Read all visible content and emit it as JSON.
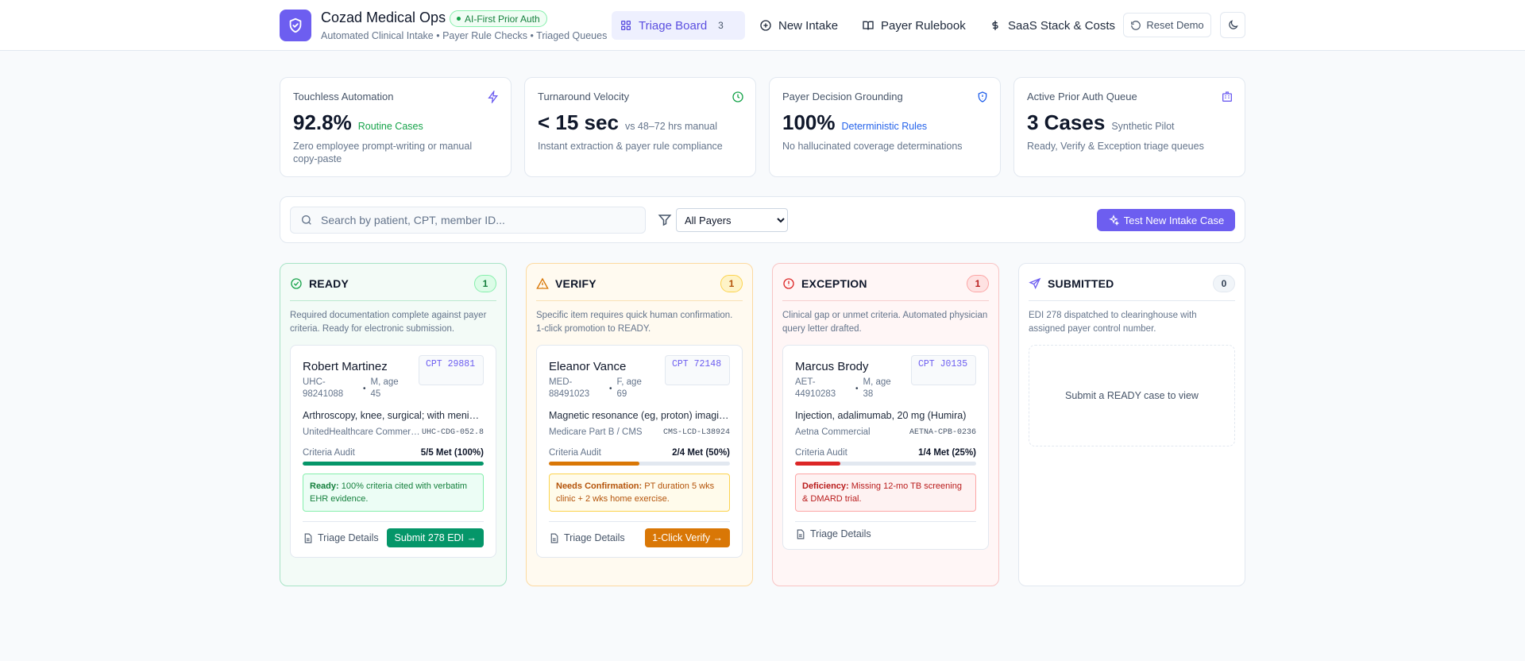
{
  "header": {
    "title": "Cozad Medical Ops",
    "badge": "AI-First Prior Auth",
    "subtitle": "Automated Clinical Intake • Payer Rule Checks • Triaged Queues",
    "nav": {
      "triage_board": "Triage Board",
      "triage_count": "3",
      "new_intake": "New Intake",
      "payer_rulebook": "Payer Rulebook",
      "saas_stack": "SaaS Stack & Costs"
    },
    "reset_label": "Reset Demo"
  },
  "stats": [
    {
      "label": "Touchless Automation",
      "value": "92.8%",
      "tag": "Routine Cases",
      "desc": "Zero employee prompt-writing or manual copy-paste",
      "icon": "zap-icon",
      "tag_color": "#16a34a"
    },
    {
      "label": "Turnaround Velocity",
      "value": "< 15 sec",
      "tag": "vs 48–72 hrs manual",
      "desc": "Instant extraction & payer rule compliance",
      "icon": "clock-icon",
      "tag_color": "#64748b"
    },
    {
      "label": "Payer Decision Grounding",
      "value": "100%",
      "tag": "Deterministic Rules",
      "desc": "No hallucinated coverage determinations",
      "icon": "shield-icon",
      "tag_color": "#2563eb"
    },
    {
      "label": "Active Prior Auth Queue",
      "value": "3 Cases",
      "tag": "Synthetic Pilot",
      "desc": "Ready, Verify & Exception triage queues",
      "icon": "building-icon",
      "tag_color": "#64748b"
    }
  ],
  "toolbar": {
    "search_placeholder": "Search by patient, CPT, member ID...",
    "payer_filter_selected": "All Payers",
    "new_case_label": "Test New Intake Case"
  },
  "columns": {
    "ready": {
      "title": "READY",
      "count": "1",
      "desc": "Required documentation complete against payer criteria. Ready for electronic submission.",
      "color": "#16a34a"
    },
    "verify": {
      "title": "VERIFY",
      "count": "1",
      "desc": "Specific item requires quick human confirmation. 1-click promotion to READY.",
      "color": "#d97706"
    },
    "exception": {
      "title": "EXCEPTION",
      "count": "1",
      "desc": "Clinical gap or unmet criteria. Automated physician query letter drafted.",
      "color": "#dc2626"
    },
    "submitted": {
      "title": "SUBMITTED",
      "count": "0",
      "desc": "EDI 278 dispatched to clearinghouse with assigned payer control number.",
      "empty": "Submit a READY case to view",
      "color": "#6d5ef0"
    }
  },
  "cases": {
    "ready": {
      "name": "Robert Martinez",
      "member_id": "UHC-98241088",
      "sep": "•",
      "demo": "M, age 45",
      "cpt": "CPT 29881",
      "procedure": "Arthroscopy, knee, surgical; with meniscectomy",
      "payer": "UnitedHealthcare Commercial",
      "payer_code": "UHC-CDG-052.8",
      "criteria_label": "Criteria Audit",
      "criteria_value": "5/5 Met (100%)",
      "criteria_fraction": 1.0,
      "note_title": "Ready:",
      "note_text": "100% criteria cited with verbatim EHR evidence.",
      "details_label": "Triage Details",
      "action_label": "Submit 278 EDI →"
    },
    "verify": {
      "name": "Eleanor Vance",
      "member_id": "MED-88491023",
      "sep": "•",
      "demo": "F, age 69",
      "cpt": "CPT 72148",
      "procedure": "Magnetic resonance (eg, proton) imaging, spinal canal",
      "payer": "Medicare Part B / CMS",
      "payer_code": "CMS-LCD-L38924",
      "criteria_label": "Criteria Audit",
      "criteria_value": "2/4 Met (50%)",
      "criteria_fraction": 0.5,
      "note_title": "Needs Confirmation:",
      "note_text": "PT duration 5 wks clinic + 2 wks home exercise.",
      "details_label": "Triage Details",
      "action_label": "1-Click Verify →"
    },
    "exception": {
      "name": "Marcus Brody",
      "member_id": "AET-44910283",
      "sep": "•",
      "demo": "M, age 38",
      "cpt": "CPT J0135",
      "procedure": "Injection, adalimumab, 20 mg (Humira)",
      "payer": "Aetna Commercial",
      "payer_code": "AETNA-CPB-0236",
      "criteria_label": "Criteria Audit",
      "criteria_value": "1/4 Met (25%)",
      "criteria_fraction": 0.25,
      "note_title": "Deficiency:",
      "note_text": "Missing 12-mo TB screening & DMARD trial.",
      "details_label": "Triage Details"
    }
  }
}
